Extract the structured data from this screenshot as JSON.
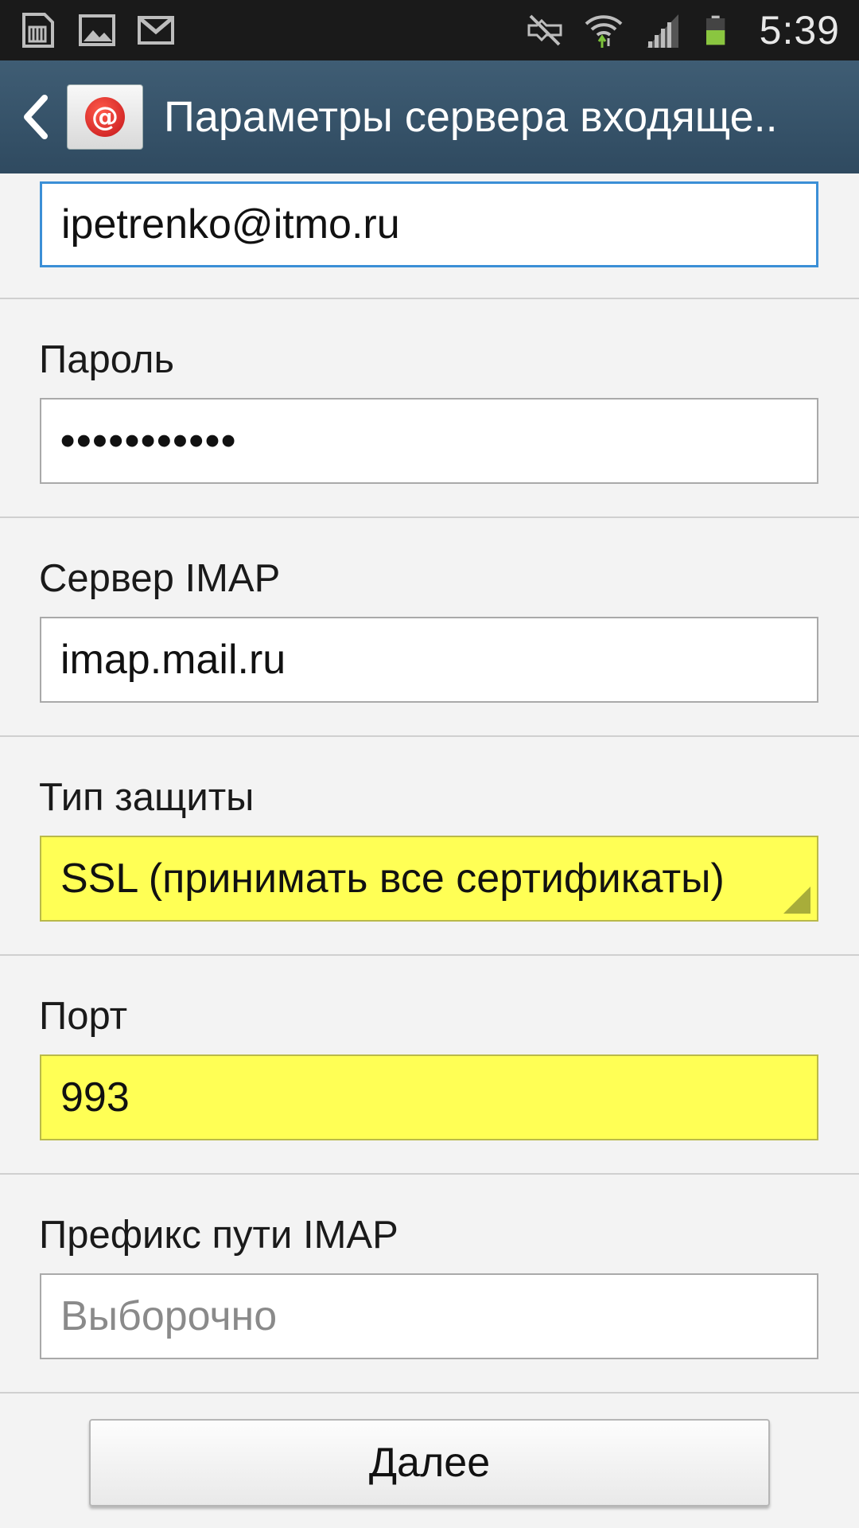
{
  "status_bar": {
    "time": "5:39",
    "left_icons": [
      "sd-card-icon",
      "image-icon",
      "gmail-icon"
    ],
    "right_icons": [
      "mute-icon",
      "wifi-icon",
      "signal-icon",
      "battery-icon"
    ]
  },
  "header": {
    "title": "Параметры сервера входяще.."
  },
  "form": {
    "username_value": "ipetrenko@itmo.ru",
    "password_label": "Пароль",
    "password_value": "•••••••••••",
    "server_label": "Сервер IMAP",
    "server_value": "imap.mail.ru",
    "security_label": "Тип защиты",
    "security_value": "SSL (принимать все сертификаты)",
    "port_label": "Порт",
    "port_value": "993",
    "prefix_label": "Префикс пути IMAP",
    "prefix_placeholder": "Выборочно"
  },
  "footer": {
    "next_label": "Далее"
  },
  "colors": {
    "highlight": "#ffff55",
    "action_bar": "#34506a",
    "focus_border": "#3b8fd6"
  }
}
